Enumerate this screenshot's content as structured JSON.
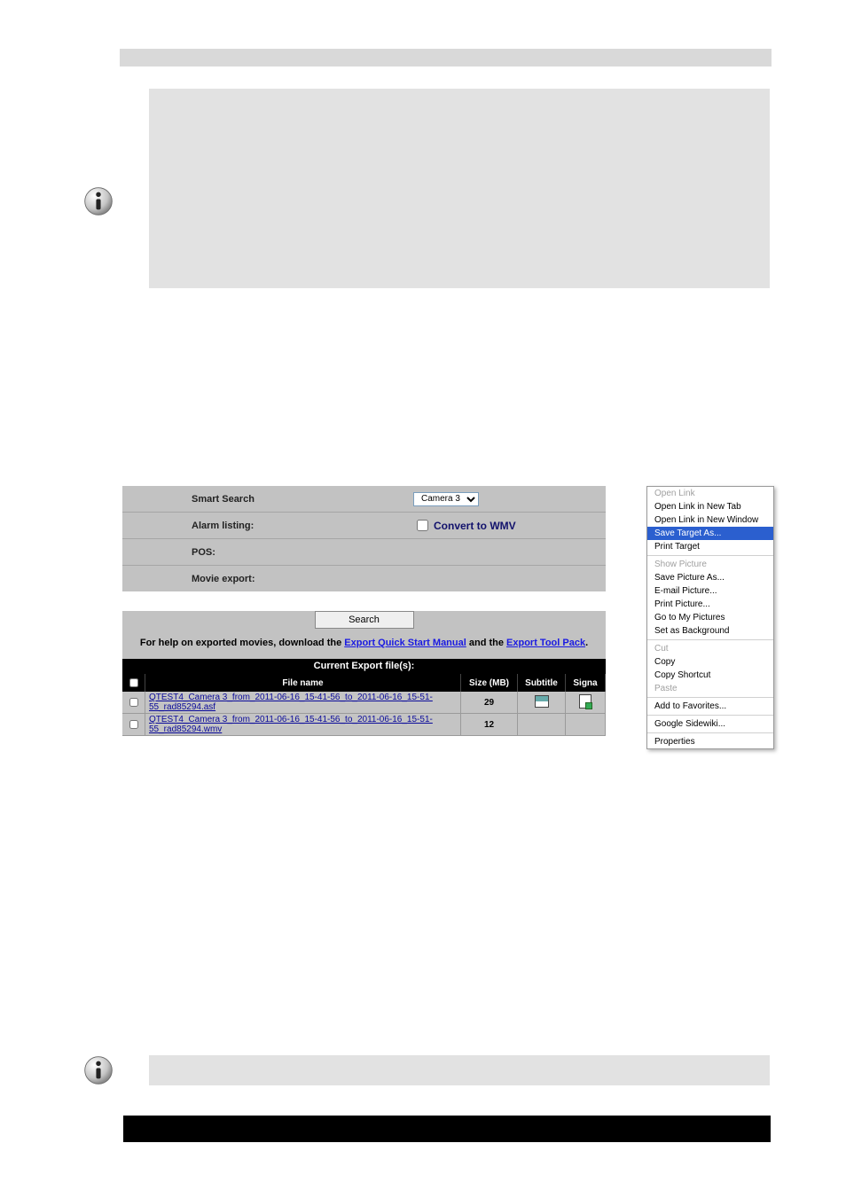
{
  "panel": {
    "smart_search": "Smart Search",
    "alarm_listing": "Alarm listing:",
    "pos": "POS:",
    "movie_export": "Movie export:",
    "camera_select": "Camera 3",
    "convert_label": "Convert to WMV",
    "search_button": "Search",
    "help_prefix": "For help on exported movies, download the ",
    "help_link1": "Export Quick Start Manual",
    "help_mid": " and the ",
    "help_link2": "Export Tool Pack",
    "help_suffix": "."
  },
  "files_header": "Current Export file(s):",
  "columns": {
    "file": "File name",
    "size": "Size (MB)",
    "subtitle": "Subtitle",
    "sign": "Signa"
  },
  "rows": [
    {
      "name": "QTEST4_Camera 3_from_2011-06-16_15-41-56_to_2011-06-16_15-51-55_rad85294.asf",
      "size": "29",
      "sub": true,
      "sig": true
    },
    {
      "name": "QTEST4_Camera 3_from_2011-06-16_15-41-56_to_2011-06-16_15-51-55_rad85294.wmv",
      "size": "12",
      "sub": false,
      "sig": false
    }
  ],
  "context_menu": {
    "open_link": "Open Link",
    "open_new_tab": "Open Link in New Tab",
    "open_new_window": "Open Link in New Window",
    "save_target": "Save Target As...",
    "print_target": "Print Target",
    "show_picture": "Show Picture",
    "save_picture": "Save Picture As...",
    "email_picture": "E-mail Picture...",
    "print_picture": "Print Picture...",
    "go_pictures": "Go to My Pictures",
    "set_bg": "Set as Background",
    "cut": "Cut",
    "copy": "Copy",
    "copy_shortcut": "Copy Shortcut",
    "paste": "Paste",
    "add_fav": "Add to Favorites...",
    "sidewiki": "Google Sidewiki...",
    "properties": "Properties"
  }
}
